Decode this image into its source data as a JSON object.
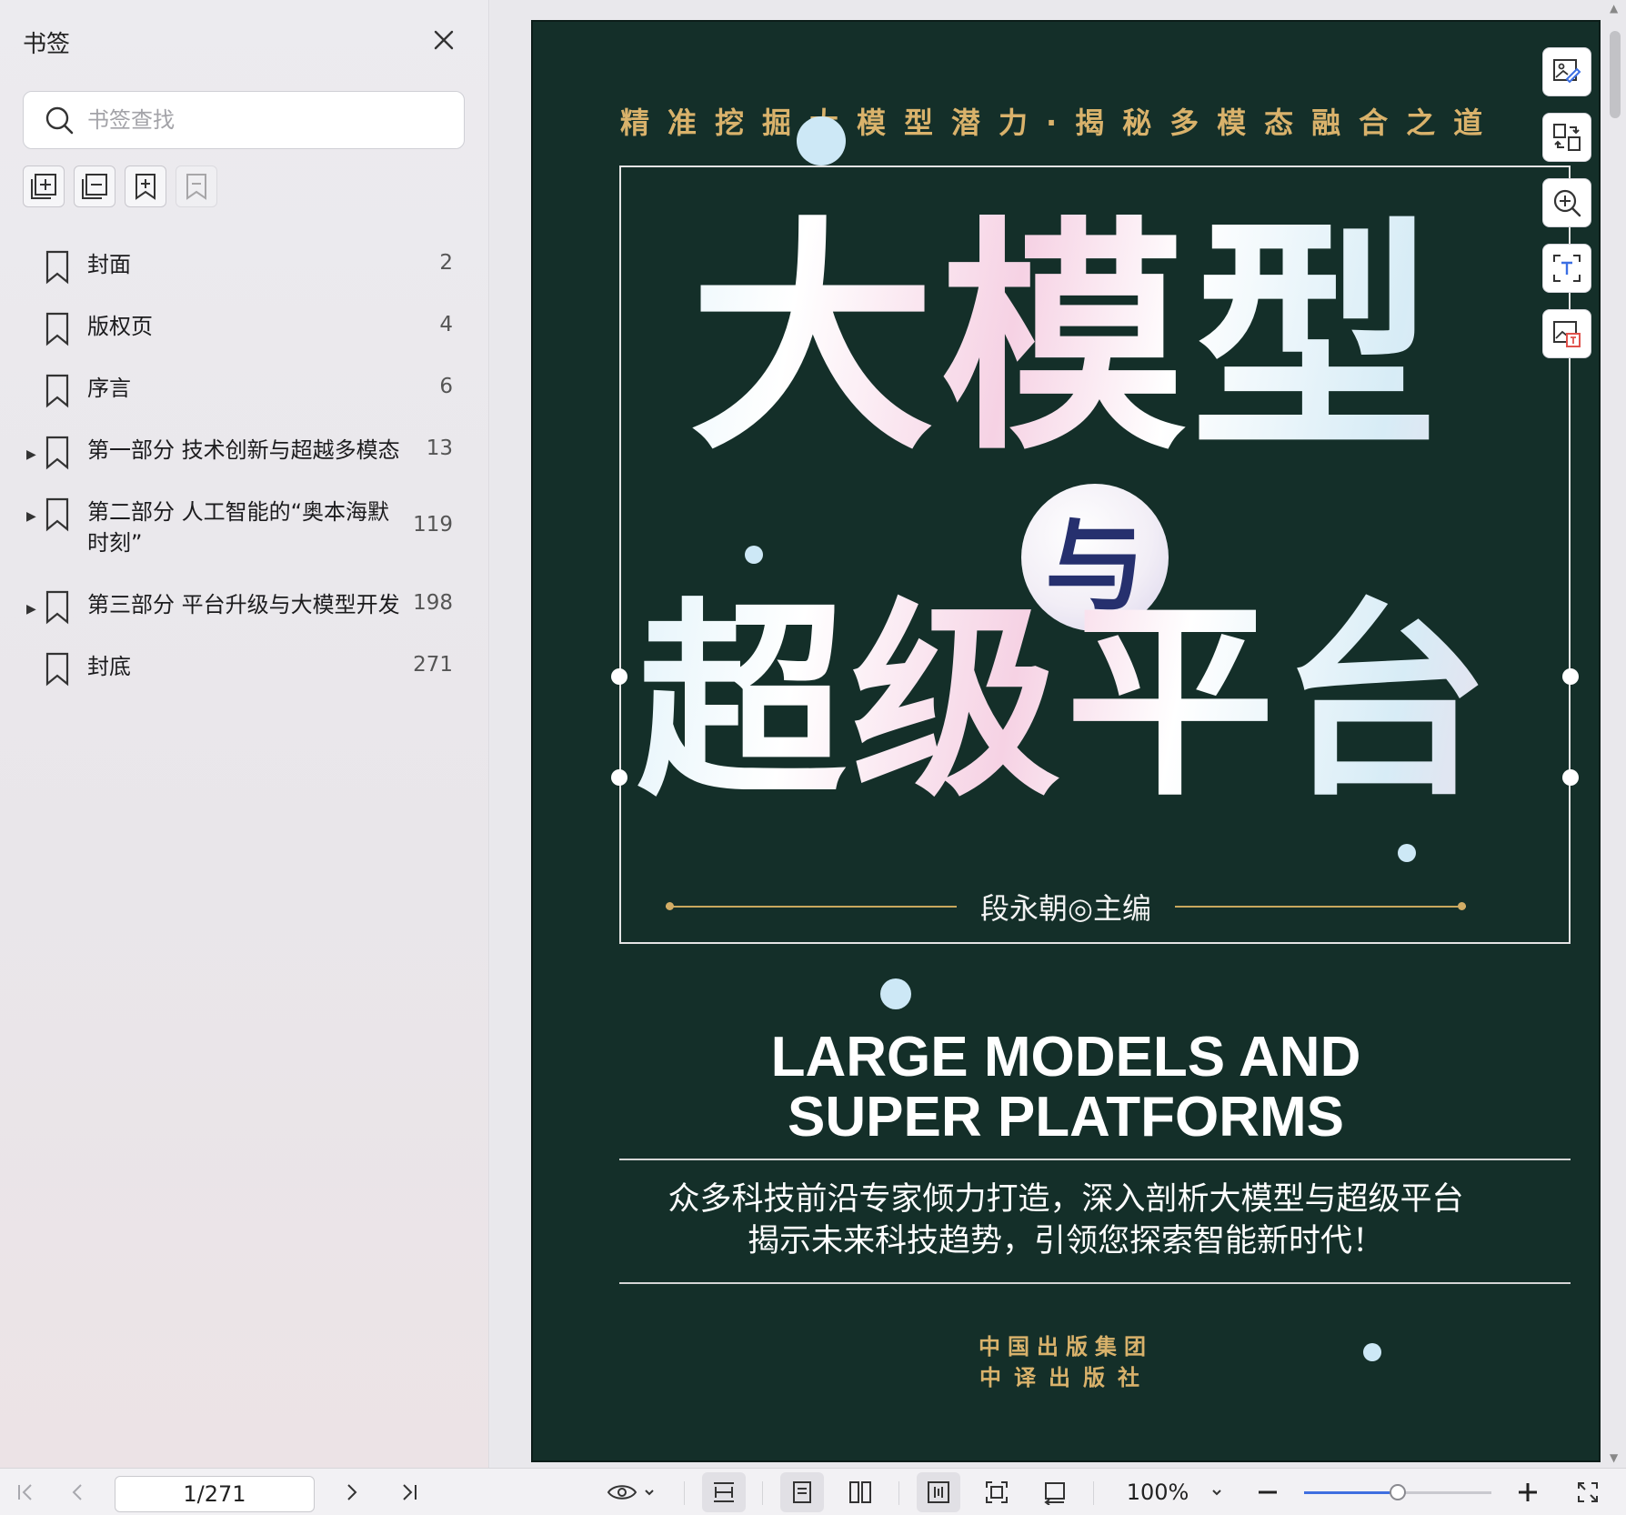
{
  "sidebar": {
    "title": "书签",
    "search_placeholder": "书签查找",
    "bookmarks": [
      {
        "label": "封面",
        "page": "2",
        "expandable": false
      },
      {
        "label": "版权页",
        "page": "4",
        "expandable": false
      },
      {
        "label": "序言",
        "page": "6",
        "expandable": false
      },
      {
        "label": "第一部分 技术创新与超越多模态",
        "page": "13",
        "expandable": true
      },
      {
        "label": "第二部分 人工智能的“奥本海默时刻”",
        "page": "119",
        "expandable": true
      },
      {
        "label": "第三部分 平台升级与大模型开发",
        "page": "198",
        "expandable": true
      },
      {
        "label": "封底",
        "page": "271",
        "expandable": false
      }
    ]
  },
  "cover": {
    "tagline": "精准挖掘大模型潜力·揭秘多模态融合之道",
    "title_line1": "大模型",
    "connector": "与",
    "title_line2": "超级平台",
    "editor": "段永朝◎主编",
    "en_title_line1": "LARGE MODELS AND",
    "en_title_line2": "SUPER PLATFORMS",
    "desc_line1": "众多科技前沿专家倾力打造，深入剖析大模型与超级平台",
    "desc_line2": "揭示未来科技趋势，引领您探索智能新时代！",
    "publisher_line1": "中国出版集团",
    "publisher_line2": "中译出版社",
    "bg_color": "#142f29",
    "accent_gold": "#d9b26b"
  },
  "floating_tools": [
    "image-edit-icon",
    "convert-icon",
    "zoom-in-icon",
    "text-recognize-icon",
    "image-translate-icon"
  ],
  "bottombar": {
    "page_indicator": "1/271",
    "zoom": "100%",
    "zoom_fraction": 0.5
  }
}
